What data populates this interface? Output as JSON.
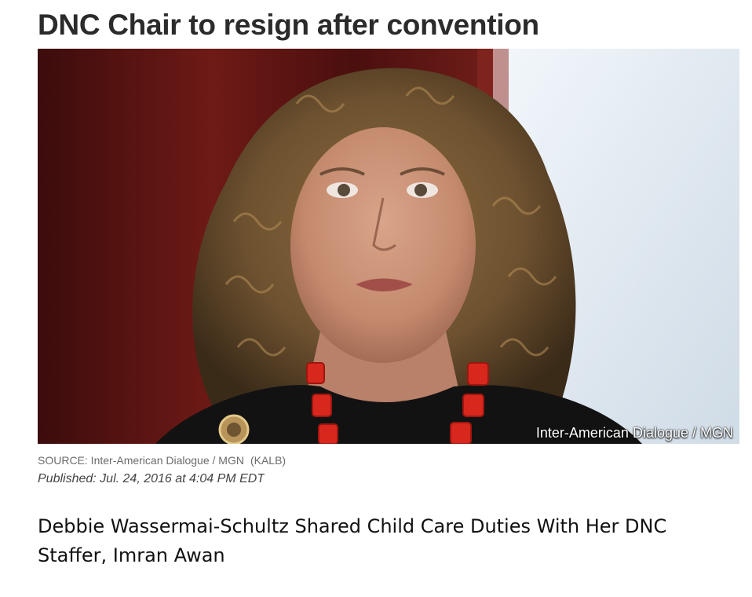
{
  "article": {
    "headline": "DNC Chair to resign after convention",
    "photo": {
      "alt": "Debbie Wasserman-Schultz",
      "credit_overlay": "Inter-American Dialogue / MGN"
    },
    "source_label": "SOURCE: Inter-American Dialogue / MGN",
    "source_station": "(KALB)",
    "published_label": "Published:",
    "published_date": "Jul. 24, 2016 at 4:04 PM EDT"
  },
  "caption": {
    "text": "Debbie Wassermai-Schultz Shared Child Care Duties With Her DNC Staffer, Imran Awan"
  },
  "colors": {
    "background": "#ffffff",
    "headline": "#2b2b2b",
    "meta_text": "#6b6b6b",
    "caption_text": "#111111"
  }
}
